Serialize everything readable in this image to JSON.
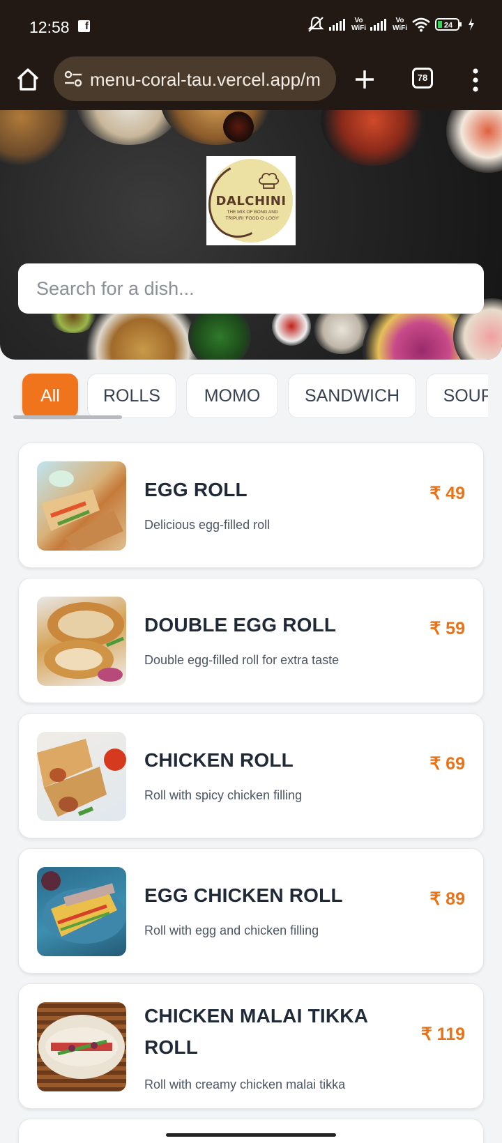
{
  "status_bar": {
    "time": "12:58",
    "battery": "24",
    "icons": [
      "facebook-icon",
      "mute-icon",
      "signal-icon",
      "vowifi-icon",
      "signal-icon",
      "vowifi-icon",
      "wifi-icon",
      "battery-icon",
      "charging-icon"
    ],
    "vowifi_top": "Vo",
    "vowifi_bottom": "WiFi"
  },
  "browser": {
    "url": "menu-coral-tau.vercel.app/m",
    "tab_count": "78"
  },
  "hero": {
    "logo": {
      "brand": "DALCHINI",
      "tagline": "THE MIX OF BONG AND TRIPURI 'FOOD O' LOGY'"
    },
    "search": {
      "placeholder": "Search for a dish..."
    }
  },
  "categories": [
    "All",
    "ROLLS",
    "MOMO",
    "SANDWICH",
    "SOUP"
  ],
  "active_category": "All",
  "currency": "₹",
  "accent_color": "#f0741c",
  "menu_items": [
    {
      "name": "EGG ROLL",
      "description": "Delicious egg-filled roll",
      "price": "₹ 49"
    },
    {
      "name": "DOUBLE EGG ROLL",
      "description": "Double egg-filled roll for extra taste",
      "price": "₹ 59"
    },
    {
      "name": "CHICKEN ROLL",
      "description": "Roll with spicy chicken filling",
      "price": "₹ 69"
    },
    {
      "name": "EGG CHICKEN ROLL",
      "description": "Roll with egg and chicken filling",
      "price": "₹ 89"
    },
    {
      "name": "CHICKEN MALAI TIKKA ROLL",
      "description": "Roll with creamy chicken malai tikka",
      "price": "₹ 119"
    }
  ]
}
